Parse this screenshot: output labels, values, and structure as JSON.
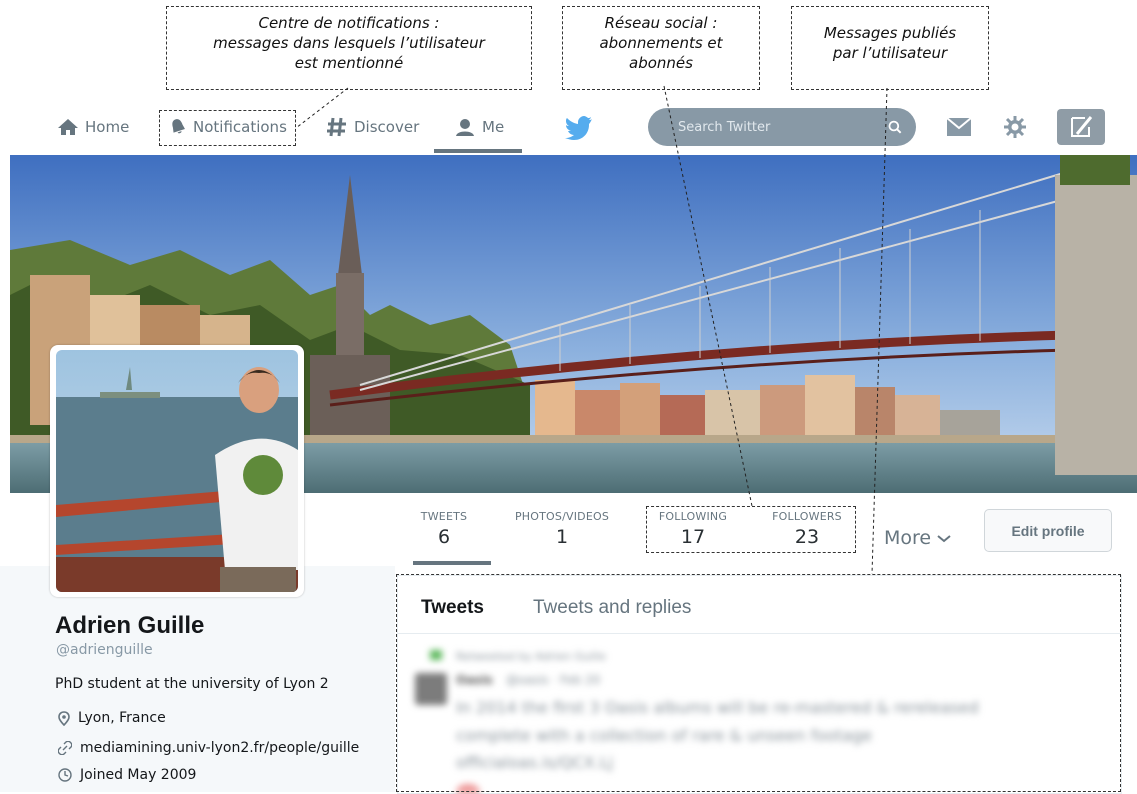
{
  "annotations": {
    "notifications_callout": [
      "Centre de notifications :",
      "messages dans lesquels l’utilisateur",
      "est mentionné"
    ],
    "network_callout": [
      "Réseau social :",
      "abonnements et",
      "abonnés"
    ],
    "messages_callout": [
      "Messages publiés",
      "par l’utilisateur"
    ]
  },
  "nav": {
    "home": "Home",
    "notifications": "Notifications",
    "discover": "Discover",
    "me": "Me",
    "search_placeholder": "Search Twitter"
  },
  "profile": {
    "name": "Adrien Guille",
    "handle": "@adrienguille",
    "bio": "PhD student at the university of Lyon 2",
    "location": "Lyon, France",
    "website": "mediamining.univ-lyon2.fr/people/guille",
    "joined": "Joined May 2009"
  },
  "stats": {
    "tweets_label": "TWEETS",
    "tweets_value": "6",
    "photos_label": "PHOTOS/VIDEOS",
    "photos_value": "1",
    "following_label": "FOLLOWING",
    "following_value": "17",
    "followers_label": "FOLLOWERS",
    "followers_value": "23",
    "more_label": "More",
    "edit_profile": "Edit profile"
  },
  "timeline": {
    "tab_tweets": "Tweets",
    "tab_replies": "Tweets and replies",
    "retweet_note": "Retweeted by Adrien Guille",
    "author": "Oasis",
    "author_meta": "@oasis · Feb 20",
    "text_line1": "In 2014 the first 3 Oasis albums will be re-mastered & rereleased",
    "text_line2": "complete with a collection of rare & unseen footage",
    "text_line3": "officialoas.is/QCX.Lj"
  },
  "colors": {
    "nav_text": "#66757f",
    "twitter_blue": "#55acee",
    "search_bg": "#8899a6",
    "profile_band": "#f5f8fa"
  }
}
